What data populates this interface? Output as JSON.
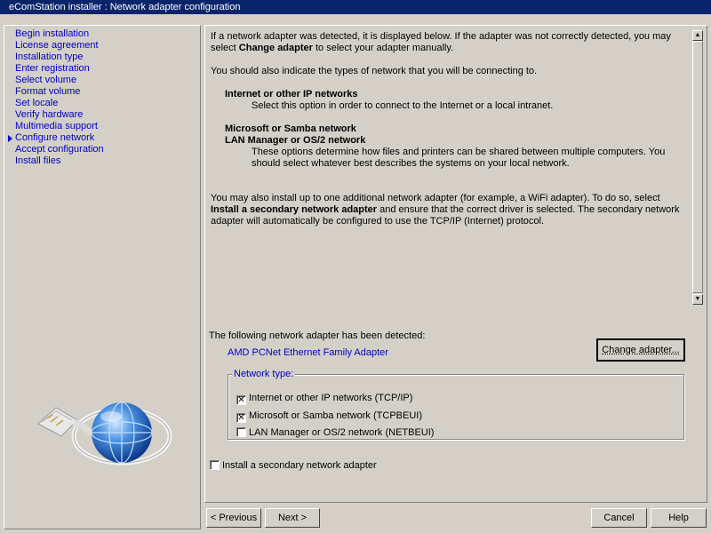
{
  "window": {
    "title": "eComStation installer : Network adapter configuration"
  },
  "sidebar": {
    "steps": [
      {
        "label": "Begin installation",
        "current": false
      },
      {
        "label": "License agreement",
        "current": false
      },
      {
        "label": "Installation type",
        "current": false
      },
      {
        "label": "Enter registration",
        "current": false
      },
      {
        "label": "Select volume",
        "current": false
      },
      {
        "label": "Format volume",
        "current": false
      },
      {
        "label": "Set locale",
        "current": false
      },
      {
        "label": "Verify hardware",
        "current": false
      },
      {
        "label": "Multimedia support",
        "current": false
      },
      {
        "label": "Configure network",
        "current": true
      },
      {
        "label": "Accept configuration",
        "current": false
      },
      {
        "label": "Install files",
        "current": false
      }
    ]
  },
  "info": {
    "p1_a": "If a network adapter was detected, it is displayed below.  If the adapter was not correctly detected, you may select ",
    "p1_bold": "Change adapter",
    "p1_b": " to select your adapter manually.",
    "p2": "You should also indicate the types of network that you will be connecting to.",
    "h1": "Internet or other IP networks",
    "d1": "Select this option in order to connect to the Internet or a local intranet.",
    "h2a": "Microsoft or Samba network",
    "h2b": "LAN Manager or OS/2 network",
    "d2": "These options determine how files and printers can be shared between multiple computers.  You should select whatever best describes the systems on your local network.",
    "p3_a": "You may also install up to one additional network adapter (for example, a WiFi adapter).  To do so, select ",
    "p3_bold": "Install a secondary network adapter",
    "p3_b": " and ensure that the correct driver is selected.  The secondary network adapter will automatically be configured to use the TCP/IP (Internet) protocol."
  },
  "adapter": {
    "detected_label": "The following network adapter has been detected:",
    "name": "AMD PCNet Ethernet Family Adapter",
    "change_button": "Change adapter..."
  },
  "network_type": {
    "legend": "Network type:",
    "options": [
      {
        "label": "Internet or other IP networks (TCP/IP)",
        "checked": true
      },
      {
        "label": "Microsoft or Samba network (TCPBEUI)",
        "checked": true
      },
      {
        "label": "LAN Manager or OS/2 network (NETBEUI)",
        "checked": false
      }
    ]
  },
  "secondary": {
    "label": "Install a secondary network adapter",
    "checked": false
  },
  "nav": {
    "previous": "< Previous",
    "next": "Next >",
    "cancel": "Cancel",
    "help": "Help"
  },
  "colors": {
    "titlebar": "#0a246a",
    "link": "#0000c8",
    "face": "#d4d0c8"
  }
}
